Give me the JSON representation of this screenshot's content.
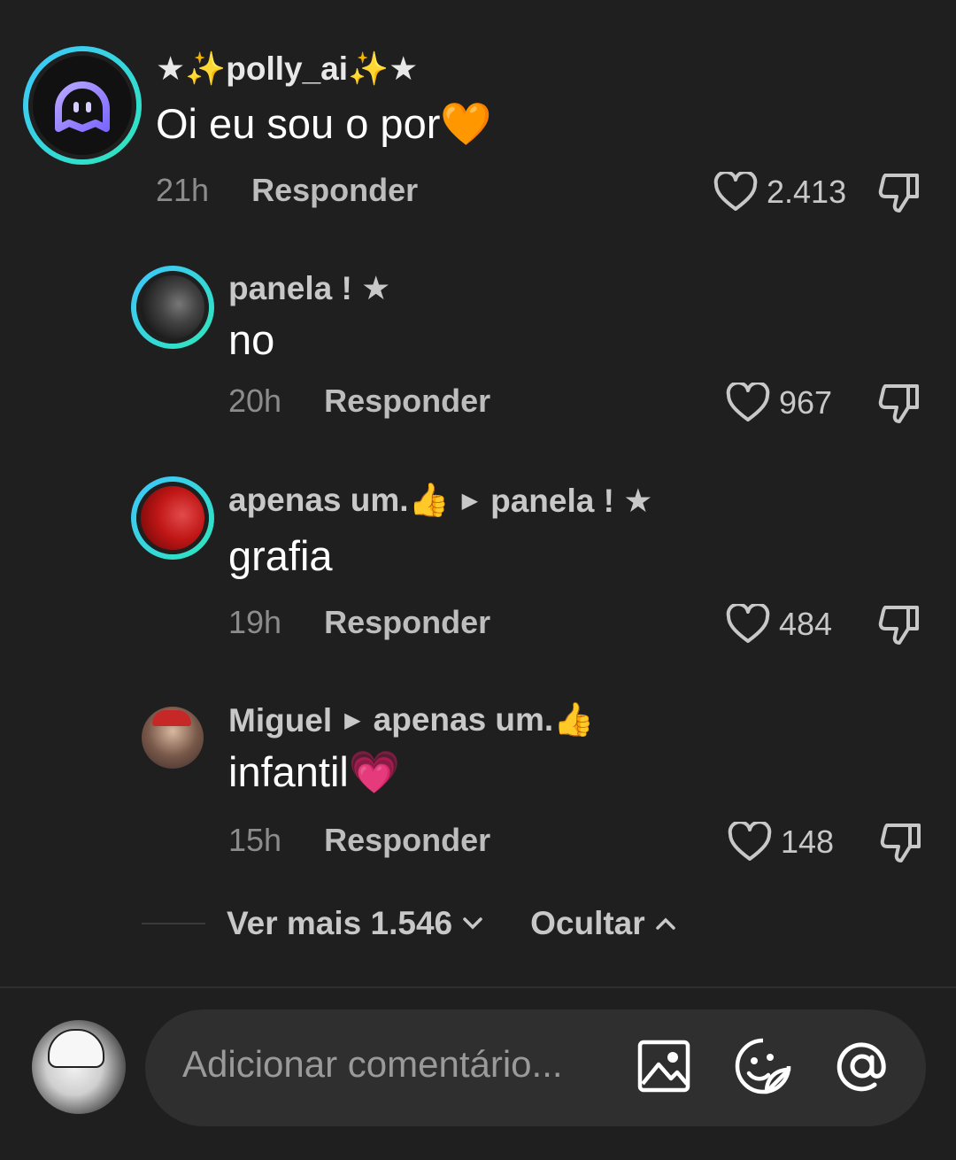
{
  "comments": [
    {
      "username": "★✨polly_ai✨★",
      "text": "Oi eu sou o por🧡",
      "time": "21h",
      "reply_label": "Responder",
      "likes": "2.413",
      "avatar": "ghost-bot-avatar"
    },
    {
      "username": "panela ! ★",
      "text": "no",
      "time": "20h",
      "reply_label": "Responder",
      "likes": "967",
      "avatar": "photo-avatar"
    },
    {
      "username": "apenas um.👍",
      "reply_to": "panela ! ★",
      "text": "grafia",
      "time": "19h",
      "reply_label": "Responder",
      "likes": "484",
      "avatar": "red-photo-avatar"
    },
    {
      "username": "Miguel",
      "reply_to": "apenas um.👍",
      "text": "infantil💗",
      "time": "15h",
      "reply_label": "Responder",
      "likes": "148",
      "avatar": "anime-avatar"
    }
  ],
  "thread_controls": {
    "view_more": "Ver mais 1.546",
    "hide": "Ocultar"
  },
  "composer": {
    "placeholder": "Adicionar comentário..."
  },
  "colors": {
    "background": "#1f1f1f",
    "ring_start": "#3ec6ff",
    "ring_end": "#2ee6b8"
  }
}
